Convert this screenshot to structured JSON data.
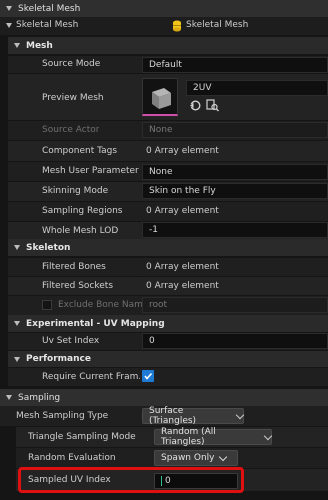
{
  "header": {
    "title": "Skeletal Mesh"
  },
  "skeletal_mesh_row": {
    "label": "Skeletal Mesh",
    "value": "Skeletal Mesh"
  },
  "mesh": {
    "title": "Mesh",
    "source_mode_label": "Source Mode",
    "source_mode_value": "Default",
    "preview_mesh_label": "Preview Mesh",
    "preview_mesh_value": "2UV",
    "source_actor_label": "Source Actor",
    "source_actor_value": "None",
    "component_tags_label": "Component Tags",
    "component_tags_value": "0 Array element",
    "mesh_user_param_label": "Mesh User Parameter",
    "mesh_user_param_value": "None",
    "skinning_mode_label": "Skinning Mode",
    "skinning_mode_value": "Skin on the Fly",
    "sampling_regions_label": "Sampling Regions",
    "sampling_regions_value": "0 Array element",
    "whole_mesh_lod_label": "Whole Mesh LOD",
    "whole_mesh_lod_value": "-1"
  },
  "skeleton": {
    "title": "Skeleton",
    "filtered_bones_label": "Filtered Bones",
    "filtered_bones_value": "0 Array element",
    "filtered_sockets_label": "Filtered Sockets",
    "filtered_sockets_value": "0 Array element",
    "exclude_bone_label": "Exclude Bone Name",
    "exclude_bone_value": "root"
  },
  "experimental": {
    "title": "Experimental - UV Mapping",
    "uv_set_index_label": "Uv Set Index",
    "uv_set_index_value": "0"
  },
  "performance": {
    "title": "Performance",
    "require_frame_label": "Require Current Fram..."
  },
  "sampling": {
    "title": "Sampling",
    "mesh_sampling_type_label": "Mesh Sampling Type",
    "mesh_sampling_type_value": "Surface (Triangles)",
    "triangle_sampling_mode_label": "Triangle Sampling Mode",
    "triangle_sampling_mode_value": "Random (All Triangles)",
    "random_evaluation_label": "Random Evaluation",
    "random_evaluation_value": "Spawn Only",
    "sampled_uv_index_label": "Sampled UV Index",
    "sampled_uv_index_value": "0"
  },
  "colors": {
    "highlight": "#e01010",
    "accent_icon": "#f0c419",
    "checkbox": "#1f7ad6"
  }
}
